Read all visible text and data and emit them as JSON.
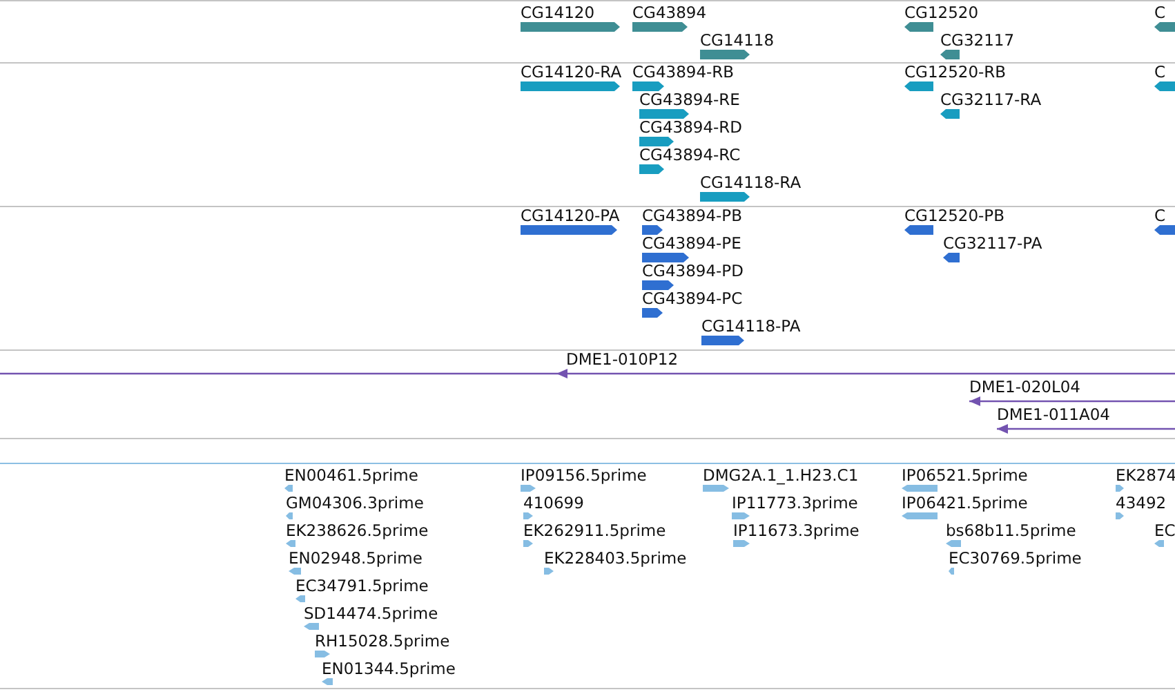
{
  "tracks": [
    {
      "kind": "gene",
      "features": [
        {
          "label": "CG14120",
          "reverse": false
        },
        {
          "label": "CG43894",
          "reverse": false
        },
        {
          "label": "CG14118",
          "reverse": false
        },
        {
          "label": "CG12520",
          "reverse": true
        },
        {
          "label": "CG32117",
          "reverse": true
        },
        {
          "label": "C",
          "reverse": true
        }
      ]
    },
    {
      "kind": "transcript",
      "features": [
        {
          "label": "CG14120-RA",
          "reverse": false
        },
        {
          "label": "CG43894-RB",
          "reverse": false
        },
        {
          "label": "CG43894-RE",
          "reverse": false
        },
        {
          "label": "CG43894-RD",
          "reverse": false
        },
        {
          "label": "CG43894-RC",
          "reverse": false
        },
        {
          "label": "CG14118-RA",
          "reverse": false
        },
        {
          "label": "CG12520-RB",
          "reverse": true
        },
        {
          "label": "CG32117-RA",
          "reverse": true
        },
        {
          "label": "C",
          "reverse": true
        }
      ]
    },
    {
      "kind": "protein",
      "features": [
        {
          "label": "CG14120-PA",
          "reverse": false
        },
        {
          "label": "CG43894-PB",
          "reverse": false
        },
        {
          "label": "CG43894-PE",
          "reverse": false
        },
        {
          "label": "CG43894-PD",
          "reverse": false
        },
        {
          "label": "CG43894-PC",
          "reverse": false
        },
        {
          "label": "CG14118-PA",
          "reverse": false
        },
        {
          "label": "CG12520-PB",
          "reverse": true
        },
        {
          "label": "CG32117-PA",
          "reverse": true
        },
        {
          "label": "C",
          "reverse": true
        }
      ]
    },
    {
      "kind": "clone",
      "features": [
        {
          "label": "DME1-010P12",
          "reverse": true
        },
        {
          "label": "DME1-020L04",
          "reverse": true
        },
        {
          "label": "DME1-011A04",
          "reverse": true
        }
      ]
    },
    {
      "kind": "est",
      "features": [
        {
          "label": "EN00461.5prime",
          "reverse": true
        },
        {
          "label": "GM04306.3prime",
          "reverse": true
        },
        {
          "label": "EK238626.5prime",
          "reverse": true
        },
        {
          "label": "EN02948.5prime",
          "reverse": true
        },
        {
          "label": "EC34791.5prime",
          "reverse": true
        },
        {
          "label": "SD14474.5prime",
          "reverse": true
        },
        {
          "label": "RH15028.5prime",
          "reverse": false
        },
        {
          "label": "EN01344.5prime",
          "reverse": true
        },
        {
          "label": "IP09156.5prime",
          "reverse": false
        },
        {
          "label": "410699",
          "reverse": false
        },
        {
          "label": "EK262911.5prime",
          "reverse": false
        },
        {
          "label": "EK228403.5prime",
          "reverse": false
        },
        {
          "label": "DMG2A.1_1.H23.C1",
          "reverse": false
        },
        {
          "label": "IP11773.3prime",
          "reverse": false
        },
        {
          "label": "IP11673.3prime",
          "reverse": false
        },
        {
          "label": "IP06521.5prime",
          "reverse": true
        },
        {
          "label": "IP06421.5prime",
          "reverse": true
        },
        {
          "label": "bs68b11.5prime",
          "reverse": true
        },
        {
          "label": "EC30769.5prime",
          "reverse": true
        },
        {
          "label": "EK2874",
          "reverse": false
        },
        {
          "label": "43492",
          "reverse": false
        },
        {
          "label": "EC",
          "reverse": true
        }
      ]
    }
  ]
}
